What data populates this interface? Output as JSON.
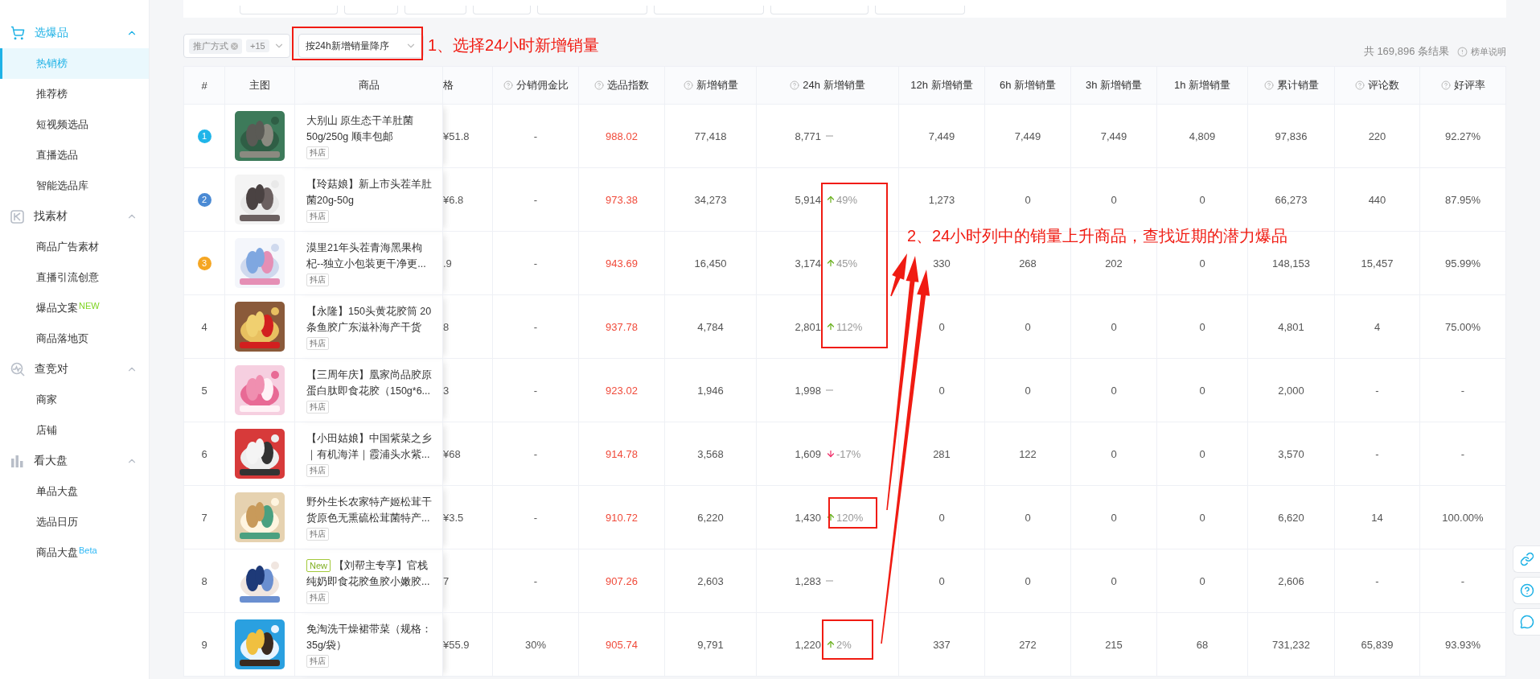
{
  "sidebar": {
    "groups": [
      {
        "title": "选爆品",
        "expanded": true,
        "active": true,
        "items": [
          {
            "label": "热销榜",
            "selected": true
          },
          {
            "label": "推荐榜",
            "selected": false
          },
          {
            "label": "短视频选品",
            "selected": false
          },
          {
            "label": "直播选品",
            "selected": false
          },
          {
            "label": "智能选品库",
            "selected": false
          }
        ]
      },
      {
        "title": "找素材",
        "expanded": true,
        "active": false,
        "items": [
          {
            "label": "商品广告素材",
            "selected": false
          },
          {
            "label": "直播引流创意",
            "selected": false
          },
          {
            "label": "爆品文案",
            "selected": false,
            "badge": {
              "text": "NEW",
              "color": "#7ed321"
            }
          },
          {
            "label": "商品落地页",
            "selected": false
          }
        ]
      },
      {
        "title": "查竞对",
        "expanded": true,
        "active": false,
        "items": [
          {
            "label": "商家",
            "selected": false
          },
          {
            "label": "店铺",
            "selected": false
          }
        ]
      },
      {
        "title": "看大盘",
        "expanded": true,
        "active": false,
        "items": [
          {
            "label": "单品大盘",
            "selected": false
          },
          {
            "label": "选品日历",
            "selected": false
          },
          {
            "label": "商品大盘",
            "selected": false,
            "badge": {
              "text": "Beta",
              "color": "#2db7f5"
            }
          }
        ]
      }
    ]
  },
  "toolbar": {
    "filter_tags": [
      "推广方式"
    ],
    "more_tags": "+15",
    "sort": "按24h新增销量降序",
    "result_count": "共 169,896 条结果",
    "help_link": "榜单说明"
  },
  "annotations": [
    {
      "text": "1、选择24小时新增销量"
    },
    {
      "text": "2、24小时列中的销量上升商品，查找近期的潜力爆品"
    }
  ],
  "table": {
    "columns": [
      {
        "label": "#",
        "help": false
      },
      {
        "label": "主图",
        "help": false
      },
      {
        "label": "商品",
        "help": false
      },
      {
        "label": "格",
        "help": false
      },
      {
        "label": "分销佣金比",
        "help": true
      },
      {
        "label": "选品指数",
        "help": true
      },
      {
        "label": "新增销量",
        "help": true
      },
      {
        "label": "24h 新增销量",
        "help": true
      },
      {
        "label": "12h 新增销量",
        "help": false
      },
      {
        "label": "6h 新增销量",
        "help": false
      },
      {
        "label": "3h 新增销量",
        "help": false
      },
      {
        "label": "1h 新增销量",
        "help": false
      },
      {
        "label": "累计销量",
        "help": true
      },
      {
        "label": "评论数",
        "help": true
      },
      {
        "label": "好评率",
        "help": true
      }
    ],
    "rows": [
      {
        "rank": "1",
        "color": "#1fb5e9",
        "title": "大别山 原生态干羊肚菌 50g/250g 顺丰包邮",
        "shop_tag": "抖店",
        "price": "¥51.8",
        "commission": "-",
        "index": "988.02",
        "new_sales": "77,418",
        "sales_24h": "8,771",
        "trend": {
          "kind": "flat"
        },
        "later": [
          "7,449",
          "7,449",
          "7,449",
          "4,809",
          "97,836",
          "220",
          "92.27%"
        ]
      },
      {
        "rank": "2",
        "color": "#4a8ad4",
        "title": "【玲菇娘】新上市头茬羊肚菌20g-50g",
        "shop_tag": "抖店",
        "price": "¥6.8",
        "commission": "-",
        "index": "973.38",
        "new_sales": "34,273",
        "sales_24h": "5,914",
        "trend": {
          "kind": "up",
          "change": "49%"
        },
        "later": [
          "1,273",
          "0",
          "0",
          "0",
          "66,273",
          "440",
          "87.95%"
        ]
      },
      {
        "rank": "3",
        "color": "#f5a623",
        "title": "漠里21年头茬青海黑果枸杞--独立小包装更干净更...",
        "shop_tag": "抖店",
        "price": ".9",
        "commission": "-",
        "index": "943.69",
        "new_sales": "16,450",
        "sales_24h": "3,174",
        "trend": {
          "kind": "up",
          "change": "45%"
        },
        "later": [
          "330",
          "268",
          "202",
          "0",
          "148,153",
          "15,457",
          "95.99%"
        ]
      },
      {
        "rank": "4",
        "title": "【永隆】150头黄花胶筒 20条鱼胶广东滋补海产干货",
        "shop_tag": "抖店",
        "price": "8",
        "commission": "-",
        "index": "937.78",
        "new_sales": "4,784",
        "sales_24h": "2,801",
        "trend": {
          "kind": "up",
          "change": "112%"
        },
        "later": [
          "0",
          "0",
          "0",
          "0",
          "4,801",
          "4",
          "75.00%"
        ]
      },
      {
        "rank": "5",
        "title": "【三周年庆】凰家尚品胶原蛋白肽即食花胶（150g*6...",
        "shop_tag": "抖店",
        "price": "3",
        "commission": "-",
        "index": "923.02",
        "new_sales": "1,946",
        "sales_24h": "1,998",
        "trend": {
          "kind": "flat"
        },
        "later": [
          "0",
          "0",
          "0",
          "0",
          "2,000",
          "-",
          "-"
        ]
      },
      {
        "rank": "6",
        "title": "【小田姑娘】中国紫菜之乡｜有机海洋｜霞浦头水紫...",
        "shop_tag": "抖店",
        "price": "¥68",
        "commission": "-",
        "index": "914.78",
        "new_sales": "3,568",
        "sales_24h": "1,609",
        "trend": {
          "kind": "down",
          "change": "-17%"
        },
        "later": [
          "281",
          "122",
          "0",
          "0",
          "3,570",
          "-",
          "-"
        ]
      },
      {
        "rank": "7",
        "title": "野外生长农家特产姬松茸干货原色无熏硫松茸菌特产...",
        "shop_tag": "抖店",
        "price": "¥3.5",
        "commission": "-",
        "index": "910.72",
        "new_sales": "6,220",
        "sales_24h": "1,430",
        "trend": {
          "kind": "up",
          "change": "120%"
        },
        "later": [
          "0",
          "0",
          "0",
          "0",
          "6,620",
          "14",
          "100.00%"
        ]
      },
      {
        "rank": "8",
        "new_badge": "New",
        "title": "【刘帮主专享】官栈纯奶即食花胶鱼胶小嫩胶...",
        "shop_tag": "抖店",
        "price": "7",
        "commission": "-",
        "index": "907.26",
        "new_sales": "2,603",
        "sales_24h": "1,283",
        "trend": {
          "kind": "flat"
        },
        "later": [
          "0",
          "0",
          "0",
          "0",
          "2,606",
          "-",
          "-"
        ]
      },
      {
        "rank": "9",
        "title": "免淘洗干燥裙带菜（规格：35g/袋）",
        "shop_tag": "抖店",
        "price": "¥55.9",
        "commission": "30%",
        "index": "905.74",
        "new_sales": "9,791",
        "sales_24h": "1,220",
        "trend": {
          "kind": "up",
          "change": "2%"
        },
        "later": [
          "337",
          "272",
          "215",
          "68",
          "731,232",
          "65,839",
          "93.93%"
        ]
      }
    ]
  }
}
